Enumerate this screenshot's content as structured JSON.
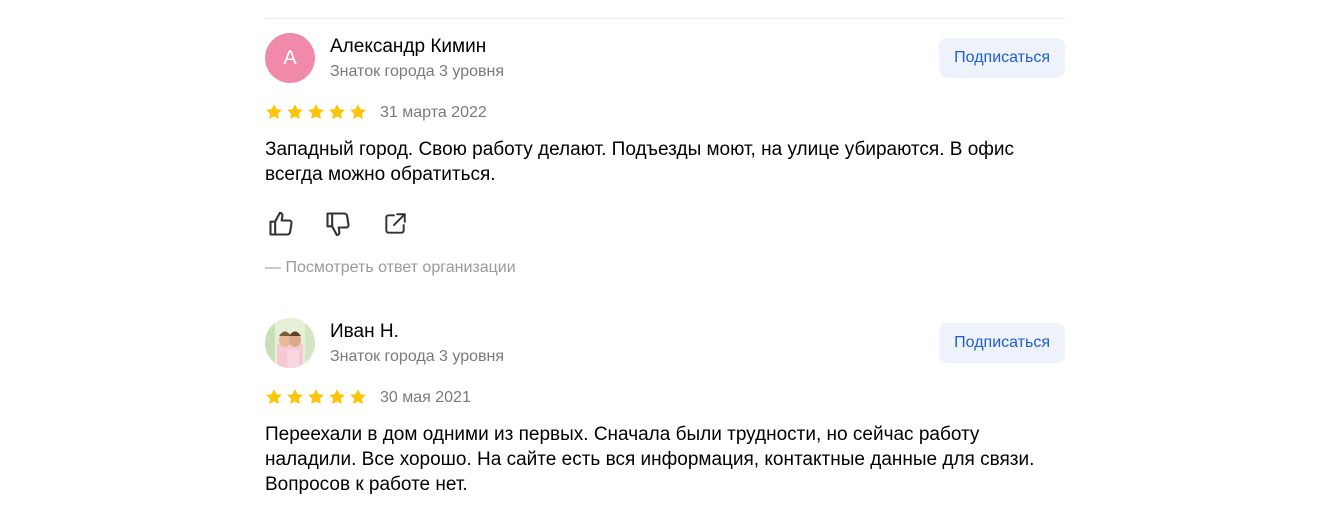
{
  "reviews": [
    {
      "author_name": "Александр Кимин",
      "avatar_letter": "А",
      "level": "Знаток города 3 уровня",
      "subscribe_label": "Подписаться",
      "rating": 5,
      "date": "31 марта 2022",
      "text": "Западный город. Свою работу делают. Подъезды моют, на улице убираются. В офис всегда можно обратиться.",
      "org_reply_label": "—  Посмотреть ответ организации"
    },
    {
      "author_name": "Иван Н.",
      "level": "Знаток города 3 уровня",
      "subscribe_label": "Подписаться",
      "rating": 5,
      "date": "30 мая 2021",
      "text": "Переехали в дом одними из первых. Сначала были трудности, но сейчас работу наладили. Все хорошо. На сайте есть вся информация, контактные данные для связи. Вопросов к работе нет."
    }
  ],
  "colors": {
    "star": "#fcc50a",
    "subscribe_bg": "#eef2fa",
    "subscribe_text": "#1f5fcf",
    "muted_text": "#7a7a7a",
    "avatar_pink": "#f08aa8"
  },
  "icons": [
    "thumbs-up-icon",
    "thumbs-down-icon",
    "share-icon",
    "star-icon"
  ]
}
